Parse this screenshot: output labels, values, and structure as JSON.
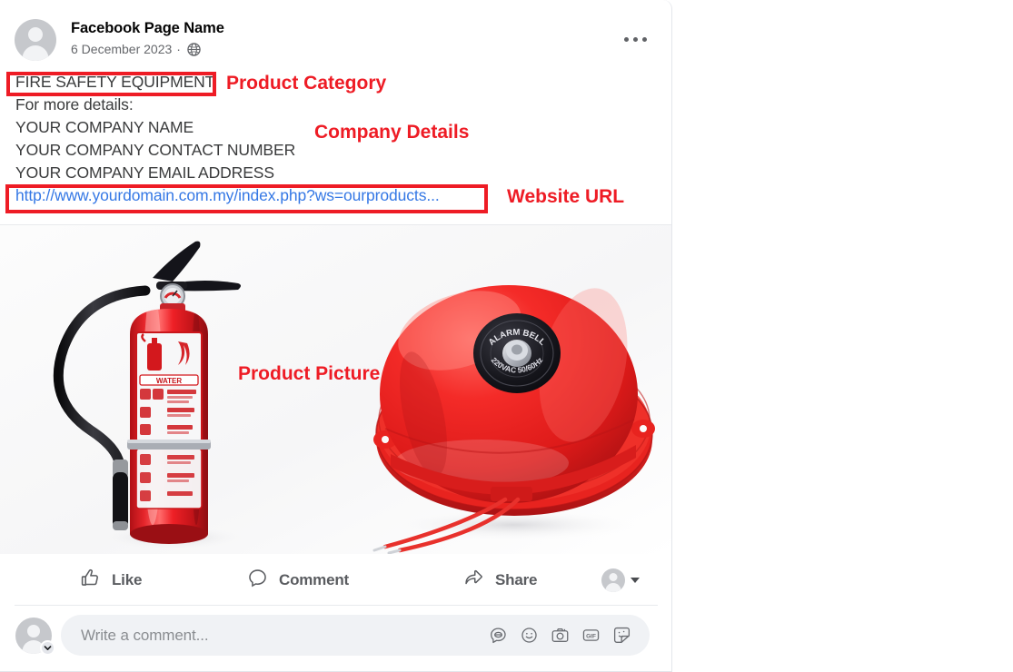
{
  "post": {
    "page_name": "Facebook Page Name",
    "date": "6 December 2023",
    "separator": "·",
    "privacy_icon": "globe-icon",
    "menu_icon": "ellipsis-icon",
    "body_lines": [
      {
        "text": "FIRE SAFETY EQUIPMENT",
        "type": "text"
      },
      {
        "text": "For more details:",
        "type": "text"
      },
      {
        "text": "YOUR COMPANY NAME",
        "type": "text"
      },
      {
        "text": "YOUR COMPANY CONTACT NUMBER",
        "type": "text"
      },
      {
        "text": "YOUR COMPANY EMAIL ADDRESS",
        "type": "text"
      },
      {
        "text": "http://www.yourdomain.com.my/index.php?ws=ourproducts...",
        "type": "link"
      }
    ]
  },
  "media": {
    "alt": "Fire extinguisher and red alarm bell on white background",
    "bell_text_top": "ALARM BELL",
    "bell_text_bottom": "220VAC 50/60Hz",
    "extinguisher_label": "WATER"
  },
  "actions": {
    "like": {
      "label": "Like",
      "icon": "thumbs-up-icon"
    },
    "comment": {
      "label": "Comment",
      "icon": "comment-bubble-icon"
    },
    "share": {
      "label": "Share",
      "icon": "share-arrow-icon"
    },
    "audience": {
      "icon": "avatar-icon",
      "caret": "chevron-down-icon"
    }
  },
  "composer": {
    "placeholder": "Write a comment...",
    "avatar_badge_icon": "chevron-down-icon",
    "icons": [
      "comment-emoji-icon",
      "smiley-icon",
      "camera-icon",
      "gif-icon",
      "sticker-icon"
    ]
  },
  "annotations": {
    "color": "#EE1C25",
    "items": [
      {
        "label": "Product Category",
        "target": "FIRE SAFETY EQUIPMENT",
        "boxed": true
      },
      {
        "label": "Company Details",
        "target": "company info lines",
        "boxed": false
      },
      {
        "label": "Website URL",
        "target": "http://www.yourdomain.com.my/index.php?ws=ourproducts...",
        "boxed": true
      },
      {
        "label": "Product Picture",
        "target": "media image",
        "boxed": false
      }
    ]
  }
}
